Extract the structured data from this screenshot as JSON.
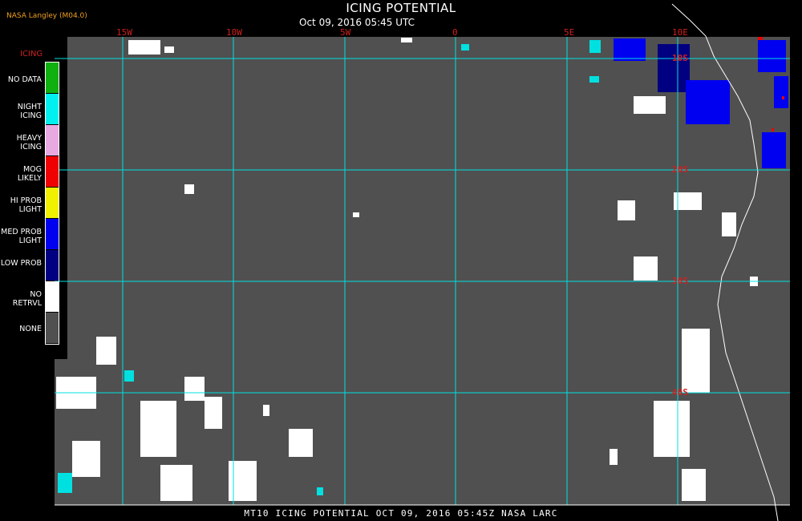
{
  "header": {
    "title": "ICING POTENTIAL",
    "subtitle": "Oct 09, 2016 05:45 UTC",
    "source": "NASA Langley (M04.0)"
  },
  "grid": {
    "lon_labels": [
      "15W",
      "10W",
      "5W",
      "0",
      "5E",
      "10E"
    ],
    "lat_labels": [
      "10S",
      "20S",
      "30S",
      "40S"
    ]
  },
  "legend": {
    "title": "ICING",
    "items": [
      {
        "label": "NO DATA",
        "color": "#10b010"
      },
      {
        "label": "NIGHT ICING",
        "color": "#00f0f0"
      },
      {
        "label": "HEAVY ICING",
        "color": "#e8a8e0"
      },
      {
        "label": "MOG LIKELY",
        "color": "#f00000"
      },
      {
        "label": "HI PROB LIGHT",
        "color": "#f0f000"
      },
      {
        "label": "MED PROB LIGHT",
        "color": "#0000f0"
      },
      {
        "label": "LOW PROB",
        "color": "#000080"
      },
      {
        "label": "NO RETRVL",
        "color": "#ffffff"
      },
      {
        "label": "NONE",
        "color": "#505050"
      }
    ]
  },
  "footer": {
    "text": "MT10   ICING POTENTIAL   OCT 09, 2016 05:45Z   NASA LARC"
  },
  "colors": {
    "background": "#505050",
    "gridline": "#00e0e0",
    "coastline": "#ffffff",
    "label": "#d02020"
  }
}
